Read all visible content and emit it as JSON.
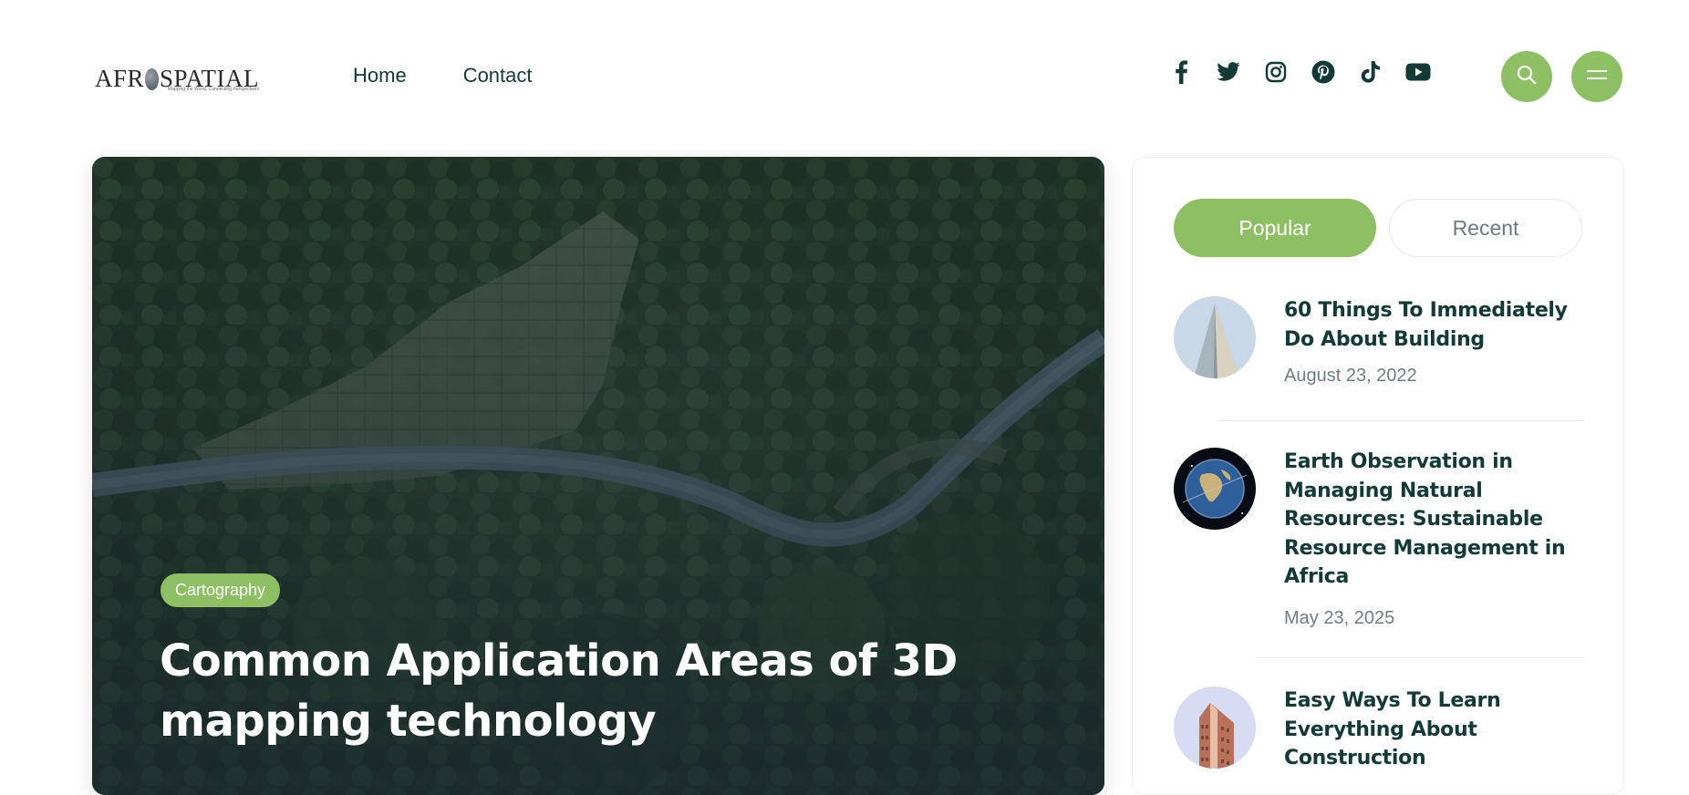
{
  "header": {
    "logo_text_left": "AFR",
    "logo_text_right": "SPATIAL",
    "logo_tagline": "Mapping the World, Connecting Perspectives",
    "nav": [
      {
        "label": "Home"
      },
      {
        "label": "Contact"
      }
    ],
    "social_icons": [
      "facebook-icon",
      "twitter-icon",
      "instagram-icon",
      "pinterest-icon",
      "tiktok-icon",
      "youtube-icon"
    ],
    "search_icon": "search-icon",
    "menu_icon": "hamburger-menu-icon"
  },
  "hero": {
    "category": "Cartography",
    "title": "Common Application Areas of 3D mapping technology",
    "background": "aerial forest river"
  },
  "sidebar": {
    "tabs": [
      {
        "label": "Popular",
        "active": true
      },
      {
        "label": "Recent",
        "active": false
      }
    ],
    "posts": [
      {
        "title": "60 Things To Immediately Do About Building",
        "date": "August 23, 2022",
        "thumb": "skyscraper"
      },
      {
        "title": "Earth Observation in Managing Natural Resources: Sustainable Resource Management in Africa",
        "date": "May 23, 2025",
        "thumb": "earth-globe"
      },
      {
        "title": "Easy Ways To Learn Everything About Construction",
        "date": "",
        "thumb": "flatiron-building"
      }
    ]
  },
  "colors": {
    "accent": "#8cc063",
    "heading": "#123a36",
    "muted": "#6f7f80",
    "hero_bg": "#1e3026"
  }
}
